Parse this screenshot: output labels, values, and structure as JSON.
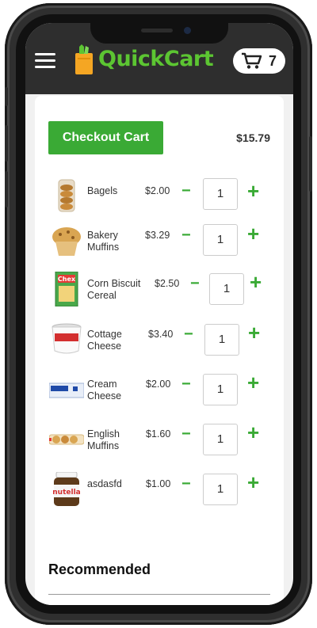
{
  "app": {
    "logo_text": "QuickCart",
    "cart_count": "7"
  },
  "cart": {
    "checkout_label": "Checkout Cart",
    "total": "$15.79",
    "items": [
      {
        "name": "Bagels",
        "price": "$2.00",
        "qty": "1",
        "image": "bagels-bag"
      },
      {
        "name": "Bakery Muffins",
        "price": "$3.29",
        "qty": "1",
        "image": "muffin"
      },
      {
        "name": "Corn Biscuit Cereal",
        "price": "$2.50",
        "qty": "1",
        "image": "chex-box"
      },
      {
        "name": "Cottage Cheese",
        "price": "$3.40",
        "qty": "1",
        "image": "cottage-cheese-tub"
      },
      {
        "name": "Cream Cheese",
        "price": "$2.00",
        "qty": "1",
        "image": "cream-cheese-brick"
      },
      {
        "name": "English Muffins",
        "price": "$1.60",
        "qty": "1",
        "image": "english-muffins-pack"
      },
      {
        "name": "asdasfd",
        "price": "$1.00",
        "qty": "1",
        "image": "nutella-jar"
      }
    ],
    "minus_symbol": "−",
    "plus_symbol": "+"
  },
  "recommended": {
    "title": "Recommended",
    "add_symbol": "+"
  },
  "colors": {
    "accent_green": "#3aaa35",
    "logo_green": "#5cc532",
    "header_bg": "#2e2e2e"
  },
  "icons": [
    "hamburger-menu-icon",
    "shopping-bag-logo-icon",
    "shopping-cart-icon"
  ]
}
